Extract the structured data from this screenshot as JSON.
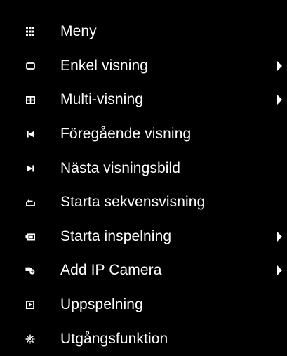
{
  "colors": {
    "background": "#000000",
    "text": "#ffffff",
    "icon": "#ffffff"
  },
  "menu": {
    "items": [
      {
        "label": "Meny",
        "icon": "menu-grid-icon",
        "has_submenu": false
      },
      {
        "label": "Enkel visning",
        "icon": "single-view-icon",
        "has_submenu": true
      },
      {
        "label": "Multi-visning",
        "icon": "multi-view-icon",
        "has_submenu": true
      },
      {
        "label": "Föregående visning",
        "icon": "previous-view-icon",
        "has_submenu": false
      },
      {
        "label": "Nästa visningsbild",
        "icon": "next-view-icon",
        "has_submenu": false
      },
      {
        "label": "Starta sekvensvisning",
        "icon": "sequence-view-icon",
        "has_submenu": false
      },
      {
        "label": "Starta inspelning",
        "icon": "record-icon",
        "has_submenu": true
      },
      {
        "label": "Add IP Camera",
        "icon": "add-ip-camera-icon",
        "has_submenu": true
      },
      {
        "label": "Uppspelning",
        "icon": "playback-icon",
        "has_submenu": false
      },
      {
        "label": "Utgångsfunktion",
        "icon": "output-mode-icon",
        "has_submenu": false
      }
    ]
  }
}
